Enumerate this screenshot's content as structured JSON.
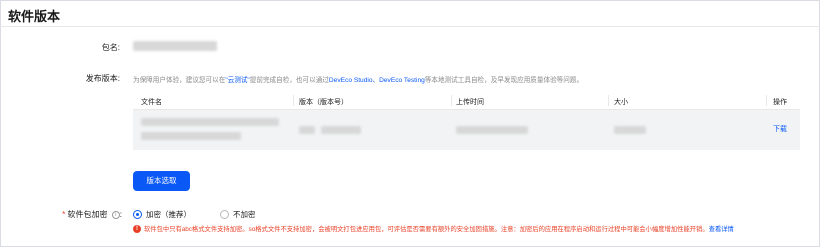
{
  "page": {
    "title": "软件版本"
  },
  "package": {
    "label": "包名:"
  },
  "release": {
    "label": "发布版本:",
    "hint_prefix": "为保障用户体验，建议您可以在",
    "hint_link1": "\"云测试\"",
    "hint_mid": "提前完成自检，也可以通过",
    "hint_link2": "DevEco Studio、DevEco Testing",
    "hint_suffix": "等本地测试工具自检，及早发现应用质量体验等问题。"
  },
  "table": {
    "columns": [
      "文件名",
      "版本（版本号）",
      "上传时间",
      "大小",
      "操作"
    ],
    "row_action": "下载"
  },
  "select_button": "版本选取",
  "encrypt": {
    "label": "软件包加密",
    "info_icon": "i",
    "options": [
      {
        "label": "加密（推荐）",
        "selected": true
      },
      {
        "label": "不加密",
        "selected": false
      }
    ],
    "warning": "软件包中只有abc格式文件支持加密。so格式文件不支持加密，会被明文打包进应用包，可评估是否需要有额外的安全加固措施。注意：加密后的应用在程序启动和运行过程中可能会小幅度增加性能开销。",
    "warning_link": "查看详情",
    "warning_icon": "!"
  },
  "colors": {
    "accent": "#0a59f7",
    "error": "#e84026"
  }
}
